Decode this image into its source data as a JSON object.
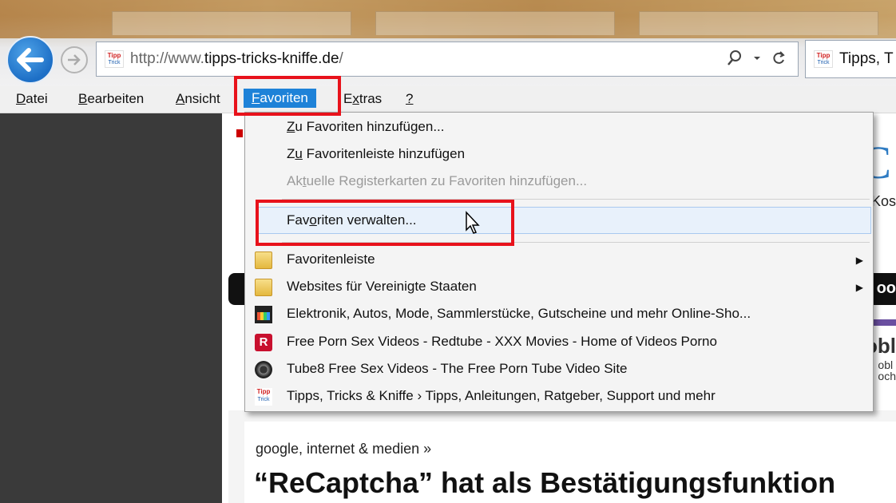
{
  "browser": {
    "url_prefix": "http://www.",
    "url_domain": "tipps-tricks-kniffe.de",
    "url_suffix": "/",
    "tab_title": "Tipps, T",
    "site_icon_top": "Tipp",
    "site_icon_bottom": "Trick",
    "search_icon": "magnifier-icon",
    "refresh_icon": "refresh-icon"
  },
  "menubar": {
    "items": [
      {
        "label": "Datei",
        "ul": "D",
        "rest": "atei"
      },
      {
        "label": "Bearbeiten",
        "ul": "B",
        "rest": "earbeiten"
      },
      {
        "label": "Ansicht",
        "ul": "A",
        "rest": "nsicht"
      },
      {
        "label": "Favoriten",
        "ul": "F",
        "rest": "avoriten"
      },
      {
        "label": "Extras",
        "pre": "E",
        "ul": "x",
        "rest": "tras"
      },
      {
        "label": "?",
        "ul": "?",
        "rest": ""
      }
    ]
  },
  "dropdown": {
    "add_fav": {
      "ul": "Z",
      "rest": "u Favoriten hinzufügen..."
    },
    "add_bar": {
      "pre": "Z",
      "ul": "u",
      "rest": " Favoritenleiste hinzufügen"
    },
    "add_tabs": {
      "pre": "Ak",
      "ul": "t",
      "rest": "uelle Registerkarten zu Favoriten hinzufügen..."
    },
    "manage": {
      "pre": "Fav",
      "ul": "o",
      "rest": "riten verwalten..."
    },
    "items": [
      "Favoritenleiste",
      "Websites für Vereinigte Staaten",
      "Elektronik, Autos, Mode, Sammlerstücke, Gutscheine und mehr Online-Sho...",
      "Free Porn Sex Videos - Redtube - XXX Movies - Home of Videos Porno",
      "Tube8  Free Sex Videos - The Free Porn Tube Video Site",
      "Tipps, Tricks & Kniffe › Tipps, Anleitungen, Ratgeber, Support und mehr"
    ],
    "r_icon_letter": "R",
    "highlight_color": "#e8121b"
  },
  "page": {
    "big_letter": "C",
    "kos": "Kos",
    "dark_bar_text": "oo",
    "obl": "obl",
    "obl2_line1": "obl",
    "obl2_line2": "och",
    "category": "google, internet & medien »",
    "headline": "“ReCaptcha” hat als Bestätigungsfunktion"
  }
}
